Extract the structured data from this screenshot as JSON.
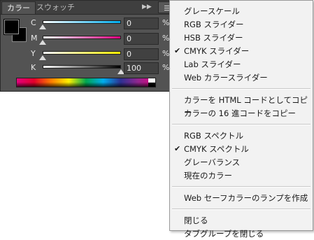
{
  "tabs": [
    {
      "label": "カラー",
      "active": true
    },
    {
      "label": "スウォッチ",
      "active": false
    }
  ],
  "tab_controls": {
    "collapse": "▶▶",
    "menu_icon": "panel-menu-icon"
  },
  "swatches": {
    "foreground": "#000000",
    "background": "#000000"
  },
  "channels": [
    {
      "label": "C",
      "value": "0",
      "percent": 0,
      "unit": "%",
      "gradient": [
        "#ffffff",
        "#00aeef"
      ]
    },
    {
      "label": "M",
      "value": "0",
      "percent": 0,
      "unit": "%",
      "gradient": [
        "#ffffff",
        "#e4007f"
      ]
    },
    {
      "label": "Y",
      "value": "0",
      "percent": 0,
      "unit": "%",
      "gradient": [
        "#ffffff",
        "#fff100"
      ]
    },
    {
      "label": "K",
      "value": "100",
      "percent": 100,
      "unit": "%",
      "gradient": [
        "#ffffff",
        "#000000"
      ]
    }
  ],
  "menu": {
    "groups": [
      [
        {
          "label": "グレースケール",
          "checked": false
        },
        {
          "label": "RGB スライダー",
          "checked": false
        },
        {
          "label": "HSB スライダー",
          "checked": false
        },
        {
          "label": "CMYK スライダー",
          "checked": true
        },
        {
          "label": "Lab スライダー",
          "checked": false
        },
        {
          "label": "Web カラースライダー",
          "checked": false
        }
      ],
      [
        {
          "label": "カラーを HTML コードとしてコピー",
          "checked": false
        },
        {
          "label": "カラーの 16 進コードをコピー",
          "checked": false
        }
      ],
      [
        {
          "label": "RGB スペクトル",
          "checked": false
        },
        {
          "label": "CMYK スペクトル",
          "checked": true
        },
        {
          "label": "グレーバランス",
          "checked": false
        },
        {
          "label": "現在のカラー",
          "checked": false
        }
      ],
      [
        {
          "label": "Web セーフカラーのランプを作成",
          "checked": false
        }
      ],
      [
        {
          "label": "閉じる",
          "checked": false
        },
        {
          "label": "タブグループを閉じる",
          "checked": false
        }
      ]
    ],
    "check_glyph": "✔"
  }
}
